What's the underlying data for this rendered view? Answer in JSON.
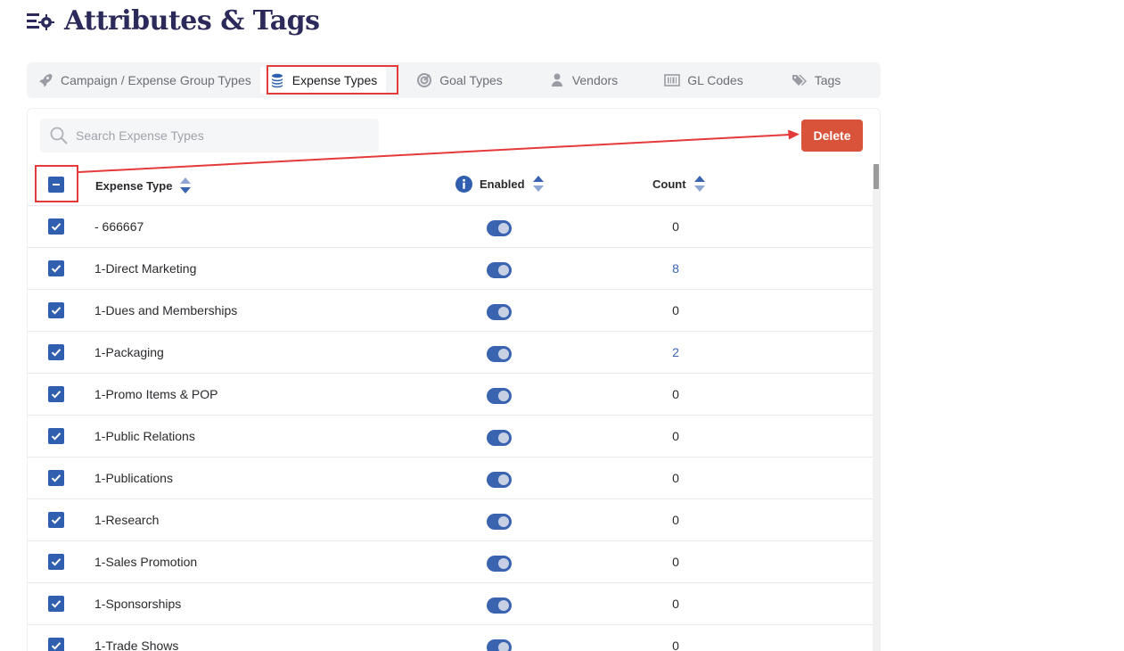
{
  "page": {
    "title": "Attributes & Tags"
  },
  "tabs": [
    {
      "label": "Campaign / Expense Group Types",
      "icon": "rocket-icon"
    },
    {
      "label": "Expense Types",
      "icon": "coins-stack-icon",
      "active": true
    },
    {
      "label": "Goal Types",
      "icon": "target-icon"
    },
    {
      "label": "Vendors",
      "icon": "user-icon"
    },
    {
      "label": "GL Codes",
      "icon": "barcode-icon"
    },
    {
      "label": "Tags",
      "icon": "tags-icon"
    }
  ],
  "search": {
    "placeholder": "Search Expense Types",
    "value": ""
  },
  "toolbar": {
    "delete_label": "Delete"
  },
  "table": {
    "headers": {
      "type": "Expense Type",
      "enabled": "Enabled",
      "count": "Count"
    },
    "rows": [
      {
        "type": "- 666667",
        "enabled": true,
        "count": "0",
        "checked": true
      },
      {
        "type": "1-Direct Marketing",
        "enabled": true,
        "count": "8",
        "checked": true
      },
      {
        "type": "1-Dues and Memberships",
        "enabled": true,
        "count": "0",
        "checked": true
      },
      {
        "type": "1-Packaging",
        "enabled": true,
        "count": "2",
        "checked": true
      },
      {
        "type": "1-Promo Items & POP",
        "enabled": true,
        "count": "0",
        "checked": true
      },
      {
        "type": "1-Public Relations",
        "enabled": true,
        "count": "0",
        "checked": true
      },
      {
        "type": "1-Publications",
        "enabled": true,
        "count": "0",
        "checked": true
      },
      {
        "type": "1-Research",
        "enabled": true,
        "count": "0",
        "checked": true
      },
      {
        "type": "1-Sales Promotion",
        "enabled": true,
        "count": "0",
        "checked": true
      },
      {
        "type": "1-Sponsorships",
        "enabled": true,
        "count": "0",
        "checked": true
      },
      {
        "type": "1-Trade Shows",
        "enabled": true,
        "count": "0",
        "checked": true
      }
    ]
  },
  "colors": {
    "accent": "#3a64b0",
    "title": "#2b2a5a",
    "delete": "#d9533a",
    "annotation": "#e53a3a"
  }
}
